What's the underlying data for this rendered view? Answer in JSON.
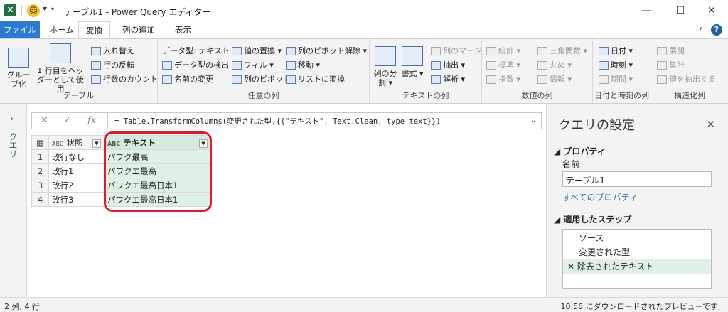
{
  "window": {
    "title": "テーブル1 - Power Query エディター",
    "minimize": "—",
    "maximize": "☐",
    "close": "✕"
  },
  "tabs": [
    {
      "label": "ファイル"
    },
    {
      "label": "ホーム"
    },
    {
      "label": "変換"
    },
    {
      "label": "列の追加"
    },
    {
      "label": "表示"
    }
  ],
  "help": "?",
  "ribbon": {
    "table_group": {
      "label": "テーブル",
      "group_by": "グループ化",
      "header_l1": "1 行目をヘッ",
      "header_l2": "ダーとして使用",
      "transpose": "入れ替え",
      "reverse": "行の反転",
      "count": "行数のカウント"
    },
    "any_group": {
      "label": "任意の列",
      "data_type": "データ型: テキスト",
      "detect": "データ型の検出",
      "rename": "名前の変更",
      "replace": "値の置換",
      "fill": "フィル",
      "pivot": "列のピボット",
      "unpivot": "列のピボット解除",
      "move": "移動",
      "to_list": "リストに変換"
    },
    "text_group": {
      "label": "テキストの列",
      "split": "列の分割",
      "format": "書式",
      "merge": "列のマージ",
      "extract": "抽出",
      "parse": "解析"
    },
    "number_group": {
      "label": "数値の列",
      "stats": "統計",
      "standard": "標準",
      "sci": "指数",
      "trig": "三角関数",
      "round": "丸め",
      "info": "情報"
    },
    "date_group": {
      "label": "日付と時刻の列",
      "date": "日付",
      "time": "時刻",
      "duration": "期間"
    },
    "struct_group": {
      "label": "構造化列",
      "expand": "展開",
      "aggregate": "集計",
      "extract_values": "値を抽出する"
    }
  },
  "sidebar": {
    "queries_label": "クエリ"
  },
  "formula": {
    "text": "= Table.TransformColumns(変更された型,{{\"テキスト\", Text.Clean, type text}})"
  },
  "grid": {
    "columns": [
      {
        "type": "ABC",
        "name": "状態"
      },
      {
        "type": "ABC",
        "name": "テキスト"
      }
    ],
    "rows": [
      {
        "n": "1",
        "state": "改行なし",
        "text": "パワク最高"
      },
      {
        "n": "2",
        "state": "改行1",
        "text": "パワクエ最高"
      },
      {
        "n": "3",
        "state": "改行2",
        "text": "パワクエ最高日本1"
      },
      {
        "n": "4",
        "state": "改行3",
        "text": "パワクエ最高日本1"
      }
    ]
  },
  "settings": {
    "title": "クエリの設定",
    "properties_header": "プロパティ",
    "name_label": "名前",
    "name_value": "テーブル1",
    "all_props": "すべてのプロパティ",
    "steps_header": "適用したステップ",
    "steps": [
      "ソース",
      "変更された型",
      "除去されたテキスト"
    ]
  },
  "status": {
    "left": "2 列, 4 行",
    "right": "10:56 にダウンロードされたプレビューです"
  }
}
